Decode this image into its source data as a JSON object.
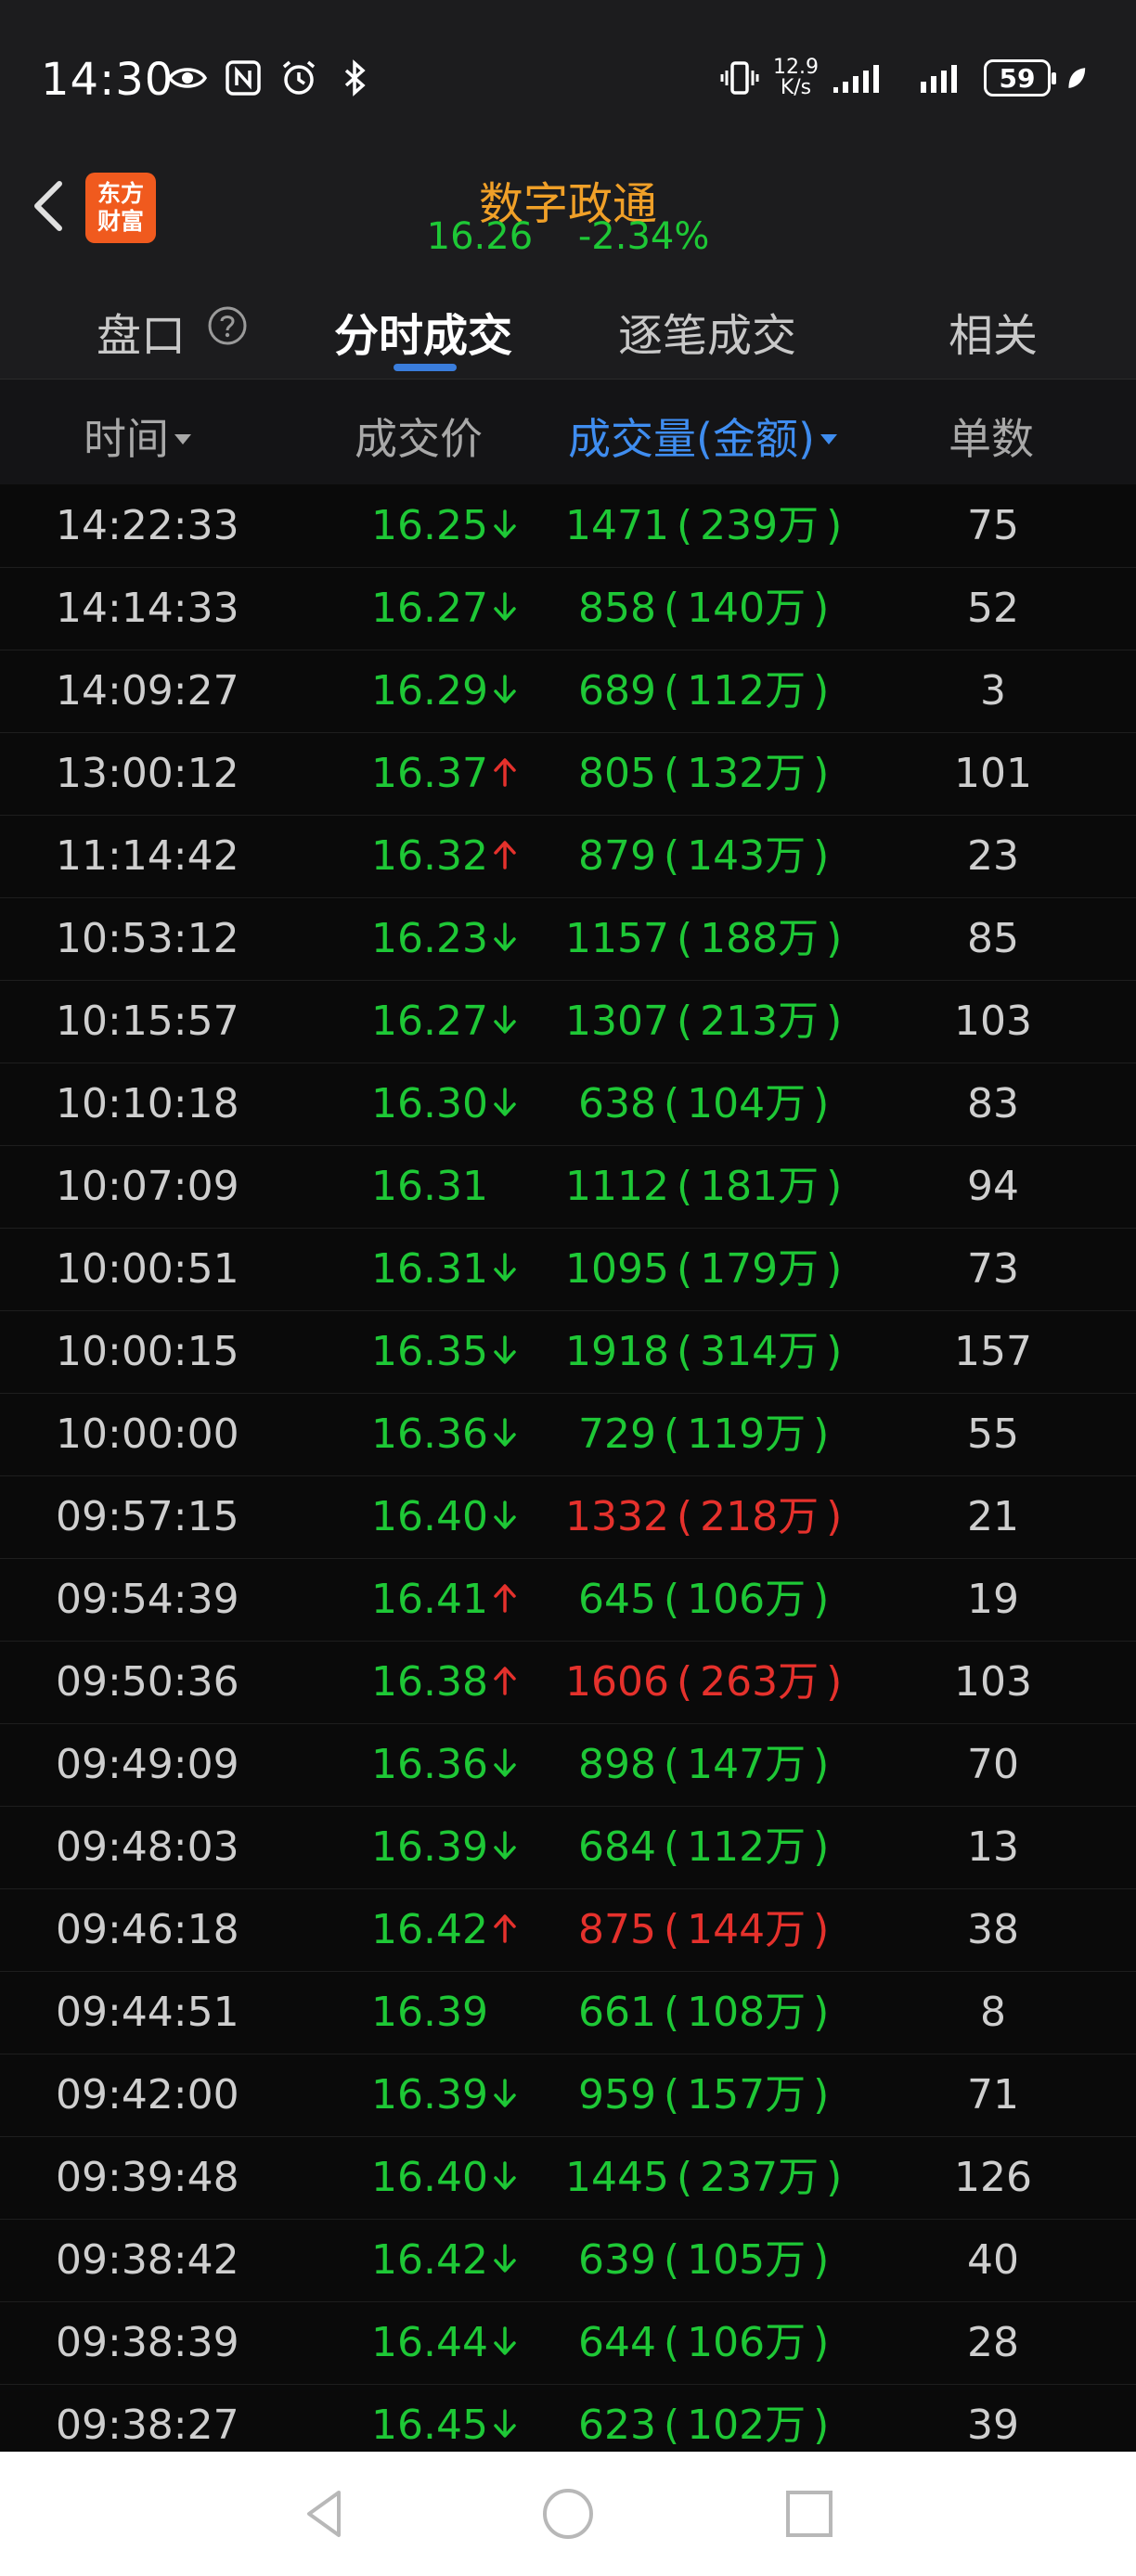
{
  "status_bar": {
    "time": "14:30",
    "speed_top": "12.9",
    "speed_bottom": "K/s",
    "battery": "59",
    "icons": [
      "eye-icon",
      "nfc-icon",
      "alarm-icon",
      "bluetooth-icon",
      "vibrate-icon",
      "signal-icon",
      "signal-icon",
      "leaf-icon"
    ]
  },
  "header": {
    "logo_line1": "东方",
    "logo_line2": "财富",
    "stock_name": "数字政通",
    "price": "16.26",
    "change_pct": "-2.34%"
  },
  "tabs": [
    {
      "label": "盘口",
      "active": false
    },
    {
      "label": "分时成交",
      "active": true
    },
    {
      "label": "逐笔成交",
      "active": false
    },
    {
      "label": "相关",
      "active": false
    }
  ],
  "columns": {
    "time": "时间",
    "price": "成交价",
    "volume": "成交量(金额)",
    "count": "单数"
  },
  "colors": {
    "up": "#e5312c",
    "down": "#1ec836",
    "accent": "#3f8df0",
    "stock_name": "#f0a028"
  },
  "trades": [
    {
      "time": "14:22:33",
      "price": "16.25",
      "dir": "down",
      "volume": "1471",
      "amount": "239万",
      "vol_color": "green",
      "count": "75"
    },
    {
      "time": "14:14:33",
      "price": "16.27",
      "dir": "down",
      "volume": "858",
      "amount": "140万",
      "vol_color": "green",
      "count": "52"
    },
    {
      "time": "14:09:27",
      "price": "16.29",
      "dir": "down",
      "volume": "689",
      "amount": "112万",
      "vol_color": "green",
      "count": "3"
    },
    {
      "time": "13:00:12",
      "price": "16.37",
      "dir": "up",
      "volume": "805",
      "amount": "132万",
      "vol_color": "green",
      "count": "101"
    },
    {
      "time": "11:14:42",
      "price": "16.32",
      "dir": "up",
      "volume": "879",
      "amount": "143万",
      "vol_color": "green",
      "count": "23"
    },
    {
      "time": "10:53:12",
      "price": "16.23",
      "dir": "down",
      "volume": "1157",
      "amount": "188万",
      "vol_color": "green",
      "count": "85"
    },
    {
      "time": "10:15:57",
      "price": "16.27",
      "dir": "down",
      "volume": "1307",
      "amount": "213万",
      "vol_color": "green",
      "count": "103"
    },
    {
      "time": "10:10:18",
      "price": "16.30",
      "dir": "down",
      "volume": "638",
      "amount": "104万",
      "vol_color": "green",
      "count": "83"
    },
    {
      "time": "10:07:09",
      "price": "16.31",
      "dir": "none",
      "volume": "1112",
      "amount": "181万",
      "vol_color": "green",
      "count": "94"
    },
    {
      "time": "10:00:51",
      "price": "16.31",
      "dir": "down",
      "volume": "1095",
      "amount": "179万",
      "vol_color": "green",
      "count": "73"
    },
    {
      "time": "10:00:15",
      "price": "16.35",
      "dir": "down",
      "volume": "1918",
      "amount": "314万",
      "vol_color": "green",
      "count": "157"
    },
    {
      "time": "10:00:00",
      "price": "16.36",
      "dir": "down",
      "volume": "729",
      "amount": "119万",
      "vol_color": "green",
      "count": "55"
    },
    {
      "time": "09:57:15",
      "price": "16.40",
      "dir": "down",
      "volume": "1332",
      "amount": "218万",
      "vol_color": "red",
      "count": "21"
    },
    {
      "time": "09:54:39",
      "price": "16.41",
      "dir": "up",
      "volume": "645",
      "amount": "106万",
      "vol_color": "green",
      "count": "19"
    },
    {
      "time": "09:50:36",
      "price": "16.38",
      "dir": "up",
      "volume": "1606",
      "amount": "263万",
      "vol_color": "red",
      "count": "103"
    },
    {
      "time": "09:49:09",
      "price": "16.36",
      "dir": "down",
      "volume": "898",
      "amount": "147万",
      "vol_color": "green",
      "count": "70"
    },
    {
      "time": "09:48:03",
      "price": "16.39",
      "dir": "down",
      "volume": "684",
      "amount": "112万",
      "vol_color": "green",
      "count": "13"
    },
    {
      "time": "09:46:18",
      "price": "16.42",
      "dir": "up",
      "volume": "875",
      "amount": "144万",
      "vol_color": "red",
      "count": "38"
    },
    {
      "time": "09:44:51",
      "price": "16.39",
      "dir": "none",
      "volume": "661",
      "amount": "108万",
      "vol_color": "green",
      "count": "8"
    },
    {
      "time": "09:42:00",
      "price": "16.39",
      "dir": "down",
      "volume": "959",
      "amount": "157万",
      "vol_color": "green",
      "count": "71"
    },
    {
      "time": "09:39:48",
      "price": "16.40",
      "dir": "down",
      "volume": "1445",
      "amount": "237万",
      "vol_color": "green",
      "count": "126"
    },
    {
      "time": "09:38:42",
      "price": "16.42",
      "dir": "down",
      "volume": "639",
      "amount": "105万",
      "vol_color": "green",
      "count": "40"
    },
    {
      "time": "09:38:39",
      "price": "16.44",
      "dir": "down",
      "volume": "644",
      "amount": "106万",
      "vol_color": "green",
      "count": "28"
    },
    {
      "time": "09:38:27",
      "price": "16.45",
      "dir": "down",
      "volume": "623",
      "amount": "102万",
      "vol_color": "green",
      "count": "39"
    }
  ]
}
